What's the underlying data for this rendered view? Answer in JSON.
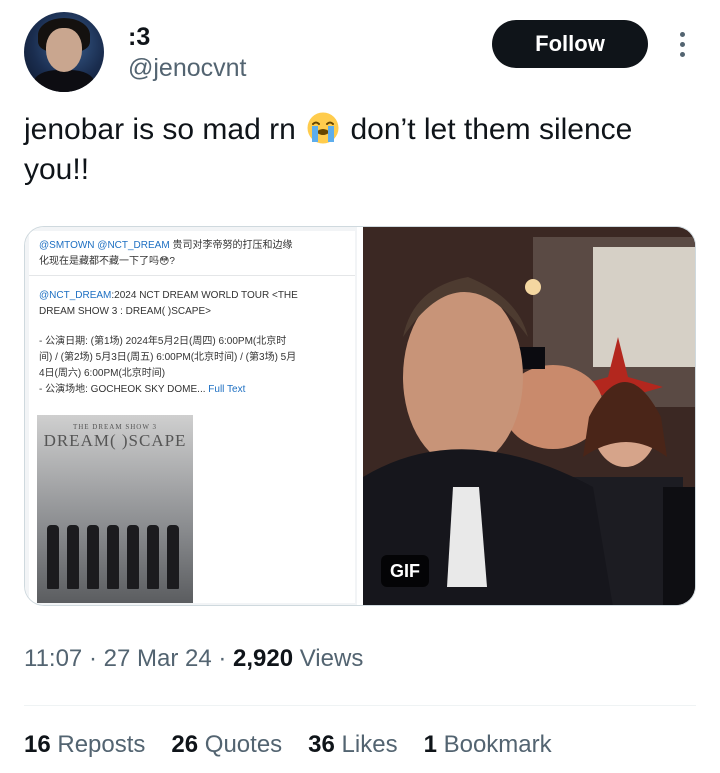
{
  "tweet": {
    "display_name": ":3",
    "handle": "@jenocvnt",
    "follow_label": "Follow",
    "text_before_emoji": "jenobar is so mad rn",
    "text_after_emoji": " don’t let them silence you!!",
    "emoji": "loudly-crying-face"
  },
  "media": {
    "gif_label": "GIF",
    "embedded_post": {
      "line1_mentions": "@SMTOWN @NCT_DREAM",
      "line1_text": " 贵司对李帝努的打压和边缘",
      "line2": "化现在是藏都不藏一下了吗😳?",
      "line3_mention": "@NCT_DREAM",
      "line3_text": ":2024 NCT DREAM WORLD TOUR <THE",
      "line4": "DREAM SHOW 3 : DREAM( )SCAPE>",
      "line5": "- 公演日期: (第1场) 2024年5月2日(周四) 6:00PM(北京时",
      "line6": "间) / (第2场) 5月3日(周五) 6:00PM(北京时间) / (第3场) 5月",
      "line7": "4日(周六) 6:00PM(北京时间)",
      "line8": "- 公演场地: GOCHEOK SKY DOME...",
      "full_text": " Full Text",
      "poster_small": "THE DREAM SHOW 3",
      "poster_big": "DREAM( )SCAPE"
    }
  },
  "meta": {
    "time": "11:07",
    "sep": " · ",
    "date": "27 Mar 24",
    "views_count": "2,920",
    "views_label": " Views"
  },
  "stats": {
    "reposts_count": "16",
    "reposts_label": " Reposts",
    "quotes_count": "26",
    "quotes_label": " Quotes",
    "likes_count": "36",
    "likes_label": " Likes",
    "bookmarks_count": "1",
    "bookmarks_label": " Bookmark"
  },
  "colors": {
    "text_primary": "#0f1419",
    "text_secondary": "#536471",
    "follow_bg": "#0f1419",
    "divider": "#eff3f4",
    "link": "#1d6fc2"
  }
}
